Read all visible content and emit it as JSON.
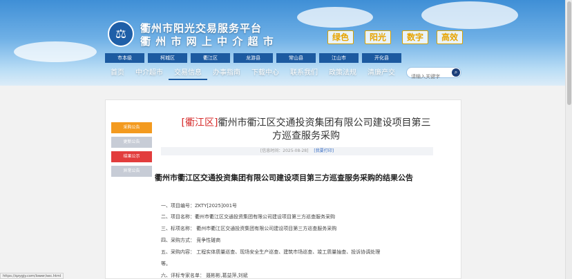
{
  "header": {
    "title_line1": "衢州市阳光交易服务平台",
    "title_line2": "衢 州 市 网 上 中 介 超 市",
    "slogans": [
      "绿色",
      "阳光",
      "数字",
      "高效"
    ]
  },
  "district_tabs": [
    "市本级",
    "柯城区",
    "衢江区",
    "龙游县",
    "常山县",
    "江山市",
    "开化县"
  ],
  "nav": {
    "items": [
      "首页",
      "中介超市",
      "交易信息",
      "办事指南",
      "下载中心",
      "联系我们",
      "政策法规",
      "清廉产交"
    ],
    "active_index": 2
  },
  "search": {
    "placeholder": "请输入关键字"
  },
  "sidebar": {
    "buttons": [
      {
        "label": "采购公告",
        "color": "#f39a1f"
      },
      {
        "label": "更新公告",
        "color": "#c7ccd6"
      },
      {
        "label": "结果公示",
        "color": "#e23d3d"
      },
      {
        "label": "异常公告",
        "color": "#c7ccd6"
      }
    ]
  },
  "article": {
    "tag": "[衢江区]",
    "title_line1": "衢州市衢江区交通投资集团有限公司建设项目第三",
    "title_line2": "方巡查服务采购",
    "meta_date": "[信息时间：2025-08-28]",
    "meta_print": "[我要打印]",
    "notice_title": "衢州市衢江区交通投资集团有限公司建设项目第三方巡查服务采购的结果公告",
    "items": [
      "一、项目编号：ZKTY[2025]001号",
      "二、项目名称：衢州市衢江区交通投资集团有限公司建设项目第三方巡查服务采购",
      "三、标项名称：  衢州市衢江区交通投资集团有限公司建设项目第三方巡查服务采购",
      "四、采购方式：  竞争性磋商",
      "五、采购内容：  工程实体质量巡查、现场安全生产巡查、建筑市场巡查、竣工质量抽查、投诉协调处理",
      "等。",
      "六、评标专家名单：  聂彬彬,葛益萍,刘斌"
    ]
  },
  "status_url": "https://qzygjy.com/lower/sec.html"
}
